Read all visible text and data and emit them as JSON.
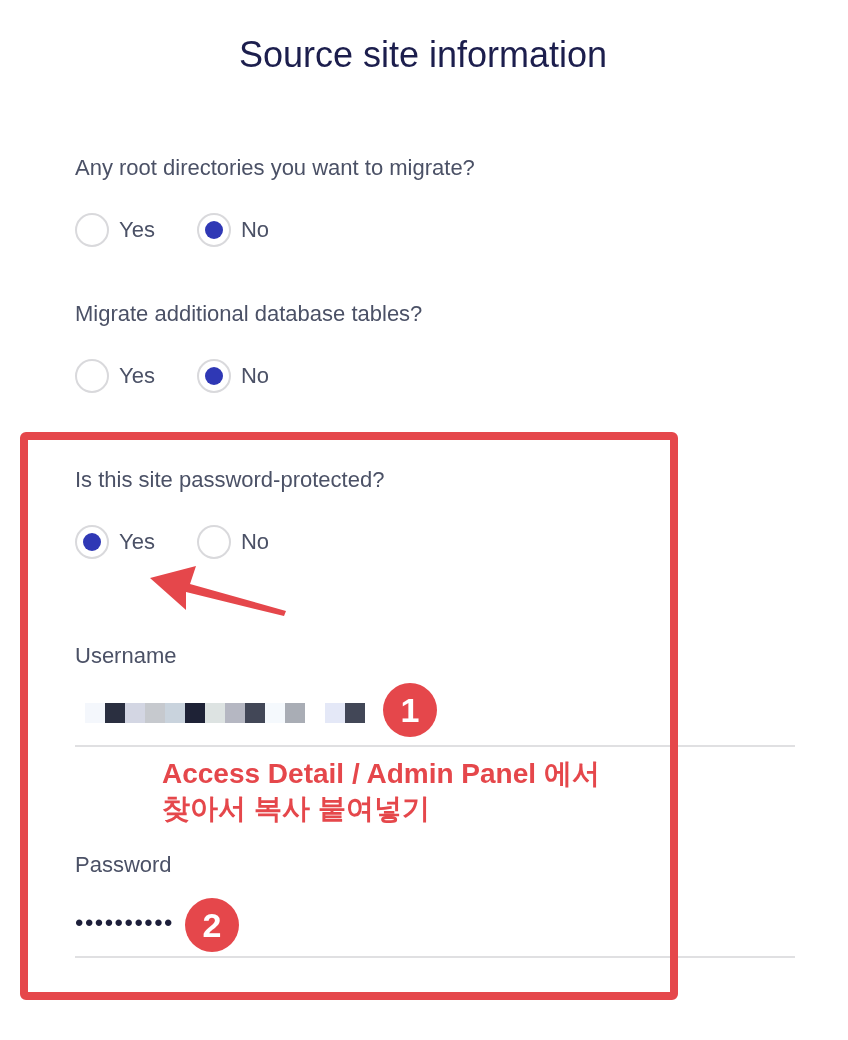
{
  "title": "Source site information",
  "questions": [
    {
      "label": "Any root directories you want to migrate?",
      "options": [
        {
          "label": "Yes",
          "selected": false
        },
        {
          "label": "No",
          "selected": true
        }
      ]
    },
    {
      "label": "Migrate additional database tables?",
      "options": [
        {
          "label": "Yes",
          "selected": false
        },
        {
          "label": "No",
          "selected": true
        }
      ]
    },
    {
      "label": "Is this site password-protected?",
      "options": [
        {
          "label": "Yes",
          "selected": true
        },
        {
          "label": "No",
          "selected": false
        }
      ]
    }
  ],
  "fields": [
    {
      "label": "Username",
      "kind": "redacted",
      "badge": "1"
    },
    {
      "label": "Password",
      "kind": "password",
      "value": "••••••••••",
      "badge": "2"
    }
  ],
  "annotation": {
    "note": "Access Detail / Admin Panel 에서\n찾아서 복사 붙여넣기"
  }
}
